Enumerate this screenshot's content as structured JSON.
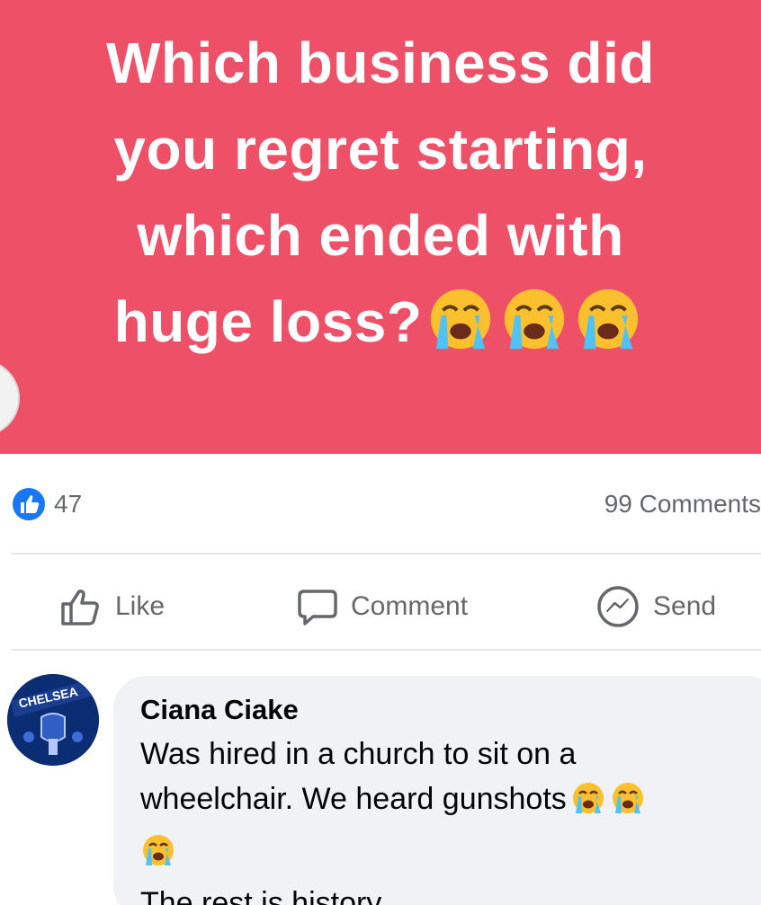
{
  "post": {
    "question_lines": [
      "Which business did",
      "you regret starting,",
      "which ended with",
      "huge loss?"
    ],
    "background_color": "#ee5068",
    "emoji": "loudly-crying-face"
  },
  "stats": {
    "reaction_icon": "thumbs-up-icon",
    "like_count": "47",
    "comments_label": "99 Comments"
  },
  "actions": {
    "like_label": "Like",
    "comment_label": "Comment",
    "send_label": "Send"
  },
  "comment": {
    "avatar_text": "CHELSEA",
    "author": "Ciana Ciake",
    "text_lines": [
      "Was hired in a church to sit on a",
      "wheelchair. We heard gunshots",
      "",
      "The rest is history"
    ]
  },
  "colors": {
    "accent_blue": "#1877f2",
    "muted_text": "#65676b",
    "bubble_bg": "#f0f2f5"
  }
}
